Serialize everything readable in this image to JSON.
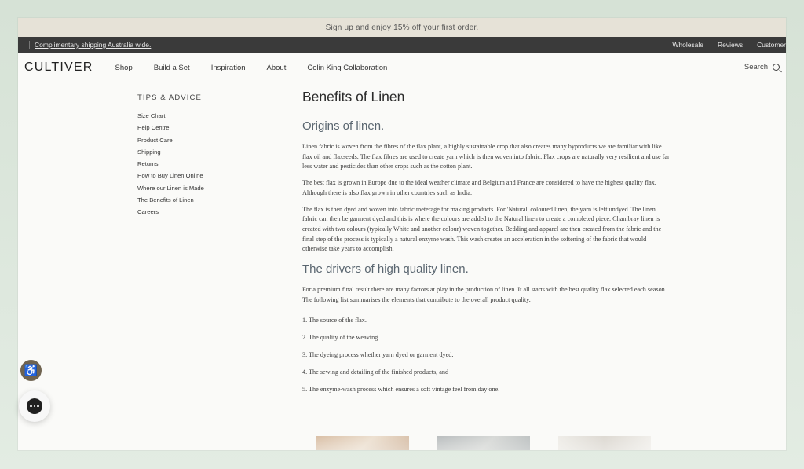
{
  "promo": {
    "text": "Sign up and enjoy 15% off your first order."
  },
  "utility": {
    "shipping_link": "Complimentary shipping Australia wide.",
    "links": [
      "Wholesale",
      "Reviews",
      "Customer"
    ]
  },
  "nav": {
    "logo": "CULTIVER",
    "menu": [
      "Shop",
      "Build a Set",
      "Inspiration",
      "About",
      "Colin King Collaboration"
    ],
    "search_label": "Search"
  },
  "sidebar": {
    "heading": "TIPS & ADVICE",
    "items": [
      "Size Chart",
      "Help Centre",
      "Product Care",
      "Shipping",
      "Returns",
      "How to Buy Linen Online",
      "Where our Linen is Made",
      "The Benefits of Linen",
      "Careers"
    ]
  },
  "article": {
    "title": "Benefits of Linen",
    "section1_heading": "Origins of linen.",
    "section1_paragraphs": [
      "Linen fabric is woven from the fibres of the flax plant, a highly sustainable crop that also creates many byproducts we are familiar with like flax oil and flaxseeds. The flax fibres are used to create yarn which is then woven into fabric. Flax crops are naturally very resilient and use far less water and pesticides than other crops such as the cotton plant.",
      "The best flax is grown in Europe due to the ideal weather climate and Belgium and France are considered to have the highest quality flax. Although there is also flax grown in other countries such as India.",
      "The flax is then dyed and woven into fabric meterage for making products. For 'Natural' coloured linen, the yarn is left undyed. The linen fabric can then be garment dyed and this is where the colours are added to the Natural linen to create a completed piece. Chambray linen is created with two colours (typically White and another colour) woven together. Bedding and apparel are then created from the fabric and the final step of the process is typically a natural enzyme wash. This wash creates an acceleration in the softening of the fabric that would otherwise take years to accomplish."
    ],
    "section2_heading": "The drivers of high quality linen.",
    "section2_intro": "For a premium final result there are many factors at play in the production of linen. It all starts with the best quality flax selected each season. The following list summarises the elements that contribute to the overall product quality.",
    "list": [
      "1. The source of the flax.",
      "2. The quality of the weaving.",
      "3. The dyeing process whether yarn dyed or garment dyed.",
      "4. The sewing and detailing of the finished products, and",
      "5. The enzyme-wash process which ensures a soft vintage feel from day one."
    ]
  },
  "widgets": {
    "accessibility_icon": "accessibility-icon",
    "chat_icon": "chat-icon"
  }
}
